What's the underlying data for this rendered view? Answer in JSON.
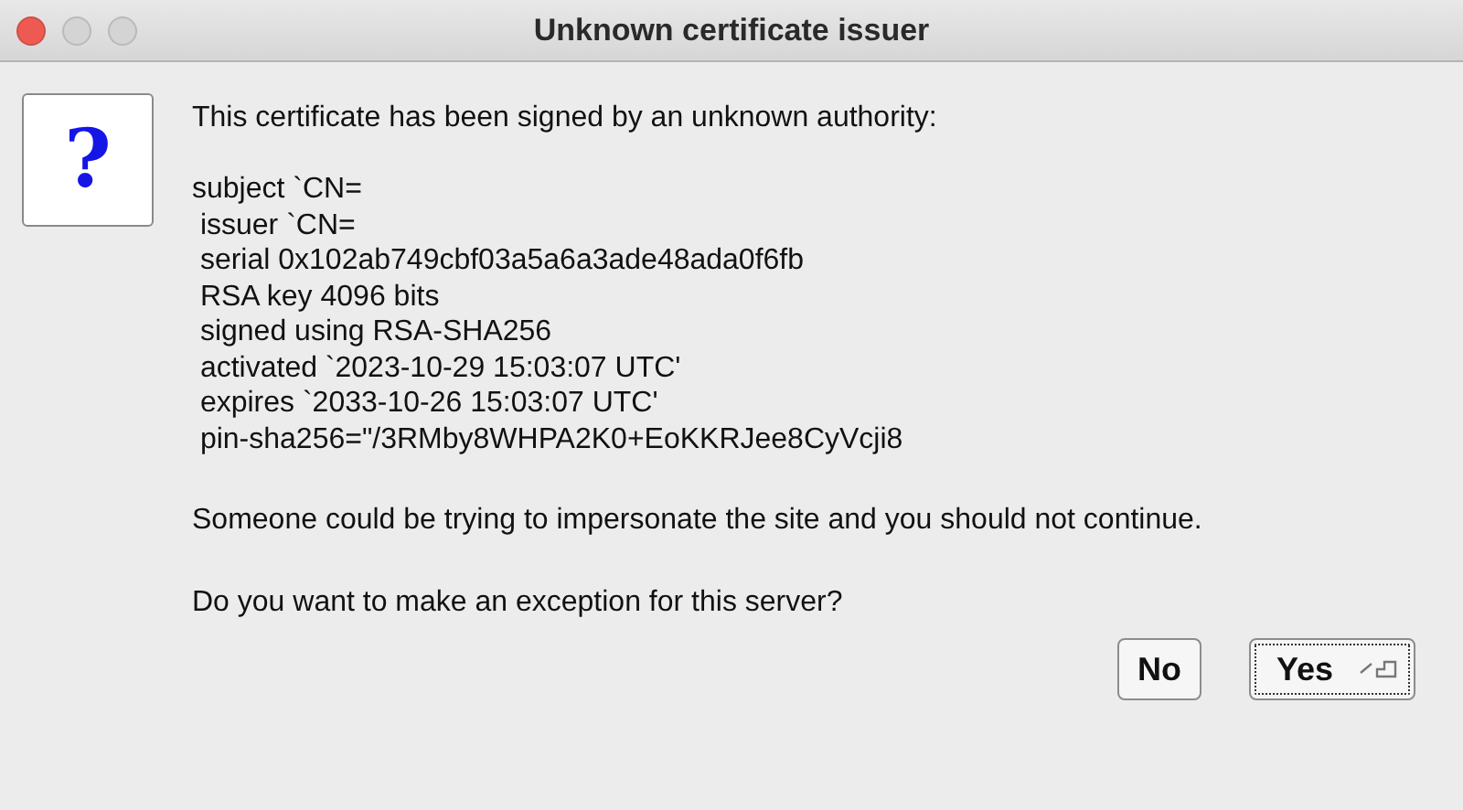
{
  "window": {
    "title": "Unknown certificate issuer"
  },
  "icon": {
    "glyph": "?"
  },
  "message": "This certificate has been signed by an unknown authority:",
  "details": [
    "subject `CN=",
    " issuer `CN=",
    " serial 0x102ab749cbf03a5a6a3ade48ada0f6fb",
    " RSA key 4096 bits",
    " signed using RSA-SHA256",
    " activated `2023-10-29 15:03:07 UTC'",
    " expires `2033-10-26 15:03:07 UTC'",
    " pin-sha256=\"/3RMby8WHPA2K0+EoKKRJee8CyVcji8"
  ],
  "warning": "Someone could be trying to impersonate the site and you should not continue.",
  "question": "Do you want to make an exception for this server?",
  "buttons": [
    {
      "label": "No",
      "default": false
    },
    {
      "label": "Yes",
      "default": true
    }
  ]
}
